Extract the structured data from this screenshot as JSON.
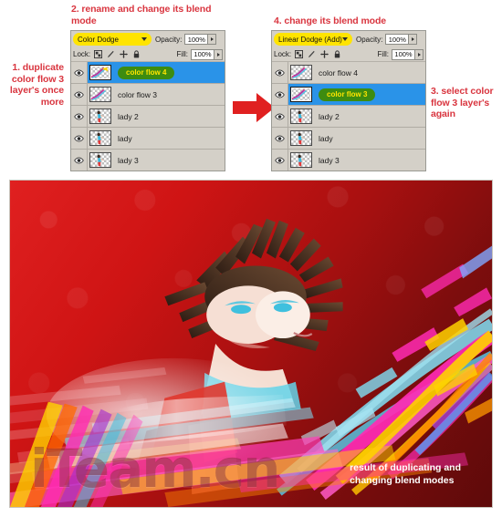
{
  "annotations": {
    "step1": "1. duplicate color flow 3 layer's once more",
    "step2": "2. rename and change its blend mode",
    "step3": "3. select color flow 3 layer's again",
    "step4": "4. change its blend mode"
  },
  "colors": {
    "annotation_red": "#d9353f",
    "arrow_red": "#e02020",
    "highlight_yellow": "#ffe400",
    "selection_blue": "#2a93e8",
    "name_pill_green": "#3d8c10",
    "panel_gray": "#d4d0c8",
    "image_background_red": "#b21b1b"
  },
  "panels": [
    {
      "id": "left",
      "blend_mode": "Color Dodge",
      "opacity_label": "Opacity:",
      "opacity_value": "100%",
      "lock_label": "Lock:",
      "lock_icons": [
        "lock-transparent-pixels-icon",
        "lock-image-pixels-icon",
        "lock-position-icon",
        "lock-all-icon"
      ],
      "fill_label": "Fill:",
      "fill_value": "100%",
      "layers": [
        {
          "name": "color flow 4",
          "visible": true,
          "selected": true,
          "highlighted_name": true,
          "thumb": "color-flow"
        },
        {
          "name": "color flow 3",
          "visible": true,
          "selected": false,
          "highlighted_name": false,
          "thumb": "color-flow"
        },
        {
          "name": "lady 2",
          "visible": true,
          "selected": false,
          "highlighted_name": false,
          "thumb": "lady"
        },
        {
          "name": "lady",
          "visible": true,
          "selected": false,
          "highlighted_name": false,
          "thumb": "lady"
        },
        {
          "name": "lady 3",
          "visible": true,
          "selected": false,
          "highlighted_name": false,
          "thumb": "lady"
        }
      ]
    },
    {
      "id": "right",
      "blend_mode": "Linear Dodge (Add)",
      "opacity_label": "Opacity:",
      "opacity_value": "100%",
      "lock_label": "Lock:",
      "lock_icons": [
        "lock-transparent-pixels-icon",
        "lock-image-pixels-icon",
        "lock-position-icon",
        "lock-all-icon"
      ],
      "fill_label": "Fill:",
      "fill_value": "100%",
      "layers": [
        {
          "name": "color flow 4",
          "visible": true,
          "selected": false,
          "highlighted_name": false,
          "thumb": "color-flow"
        },
        {
          "name": "color flow 3",
          "visible": true,
          "selected": true,
          "highlighted_name": true,
          "thumb": "color-flow"
        },
        {
          "name": "lady 2",
          "visible": true,
          "selected": false,
          "highlighted_name": false,
          "thumb": "lady"
        },
        {
          "name": "lady",
          "visible": true,
          "selected": false,
          "highlighted_name": false,
          "thumb": "lady"
        },
        {
          "name": "lady 3",
          "visible": true,
          "selected": false,
          "highlighted_name": false,
          "thumb": "lady"
        }
      ]
    }
  ],
  "result": {
    "caption_line1": "result of duplicating and",
    "caption_line2": "changing blend modes",
    "watermark": "iTeam.cn"
  }
}
